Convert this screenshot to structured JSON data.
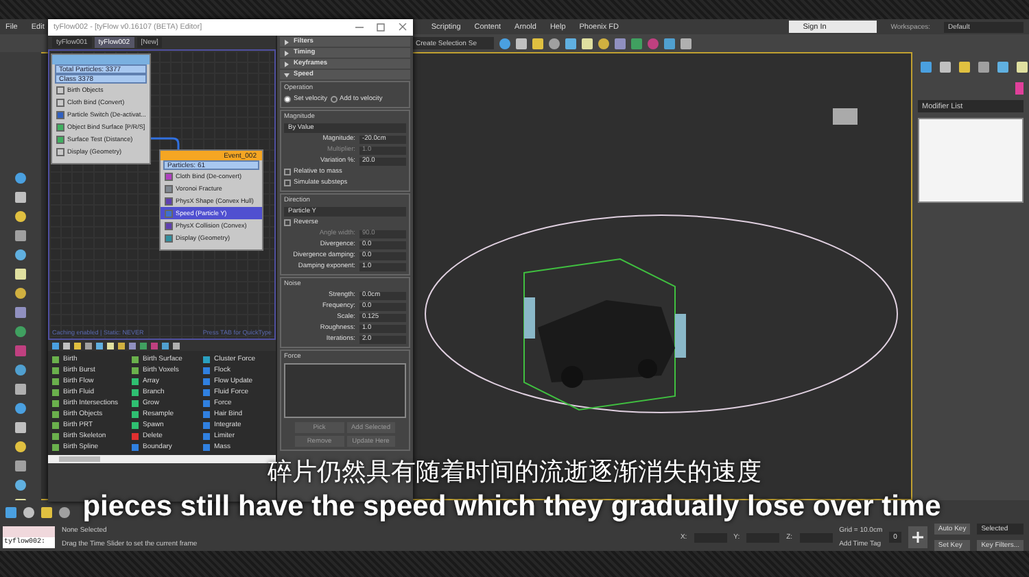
{
  "menu": {
    "left": [
      "File",
      "Edit"
    ],
    "right": [
      "Scripting",
      "Content",
      "Arnold",
      "Help",
      "Phoenix FD"
    ]
  },
  "sign_in": "Sign In",
  "workspaces": {
    "label": "Workspaces:",
    "value": "Default"
  },
  "toolbar": {
    "selection_set": "Create Selection Se"
  },
  "editor": {
    "title": "tyFlow002 - [tyFlow v0.16107 (BETA) Editor]",
    "tabs": [
      {
        "label": "tyFlow001",
        "selected": false
      },
      {
        "label": "tyFlow002",
        "selected": true
      },
      {
        "label": "[New]",
        "selected": false
      }
    ],
    "nodes": [
      {
        "stats": [
          "Total Particles: 3377",
          "Class 3378"
        ],
        "operators": [
          {
            "label": "Birth Objects",
            "selected": false,
            "color": "#c8c8c8"
          },
          {
            "label": "Cloth Bind (Convert)",
            "selected": false,
            "color": "#c8c8c8"
          },
          {
            "label": "Particle Switch (De-activat...",
            "selected": false,
            "color": "#3060c0"
          },
          {
            "label": "Object Bind Surface [P/R/S]",
            "selected": false,
            "color": "#40b060"
          },
          {
            "label": "Surface Test (Distance)",
            "selected": false,
            "color": "#40b060"
          },
          {
            "label": "Display (Geometry)",
            "selected": false,
            "color": "#c8c8c8"
          }
        ]
      },
      {
        "title": "Event_002",
        "stats": [
          "Particles: 61"
        ],
        "operators": [
          {
            "label": "Cloth Bind (De-convert)",
            "selected": false,
            "color": "#b040c0"
          },
          {
            "label": "Voronoi Fracture",
            "selected": false,
            "color": "#808890"
          },
          {
            "label": "PhysX Shape (Convex Hull)",
            "selected": false,
            "color": "#6040b0"
          },
          {
            "label": "Speed (Particle Y)",
            "selected": true,
            "color": "#4070d0"
          },
          {
            "label": "PhysX Collision (Convex)",
            "selected": false,
            "color": "#6040b0"
          },
          {
            "label": "Display (Geometry)",
            "selected": false,
            "color": "#3090a0"
          }
        ]
      }
    ],
    "status_left": "Caching enabled | Static: NEVER",
    "status_right": "Press TAB for QuickType",
    "palette": [
      [
        {
          "label": "Birth",
          "color": "#6ab04c"
        },
        {
          "label": "Birth Burst",
          "color": "#6ab04c"
        },
        {
          "label": "Birth Flow",
          "color": "#6ab04c"
        },
        {
          "label": "Birth Fluid",
          "color": "#6ab04c"
        },
        {
          "label": "Birth Intersections",
          "color": "#6ab04c"
        },
        {
          "label": "Birth Objects",
          "color": "#6ab04c"
        },
        {
          "label": "Birth PRT",
          "color": "#6ab04c"
        },
        {
          "label": "Birth Skeleton",
          "color": "#6ab04c"
        },
        {
          "label": "Birth Spline",
          "color": "#6ab04c"
        }
      ],
      [
        {
          "label": "Birth Surface",
          "color": "#6ab04c"
        },
        {
          "label": "Birth Voxels",
          "color": "#6ab04c"
        },
        {
          "label": "Array",
          "color": "#2fbf71"
        },
        {
          "label": "Branch",
          "color": "#2fbf71"
        },
        {
          "label": "Grow",
          "color": "#2fbf71"
        },
        {
          "label": "Resample",
          "color": "#2fbf71"
        },
        {
          "label": "Spawn",
          "color": "#2fbf71"
        },
        {
          "label": "Delete",
          "color": "#e03030"
        },
        {
          "label": "Boundary",
          "color": "#3080e0"
        }
      ],
      [
        {
          "label": "Cluster Force",
          "color": "#2aa0c0"
        },
        {
          "label": "Flock",
          "color": "#3080e0"
        },
        {
          "label": "Flow Update",
          "color": "#3080e0"
        },
        {
          "label": "Fluid Force",
          "color": "#3080e0"
        },
        {
          "label": "Force",
          "color": "#3080e0"
        },
        {
          "label": "Hair Bind",
          "color": "#3080e0"
        },
        {
          "label": "Integrate",
          "color": "#3080e0"
        },
        {
          "label": "Limiter",
          "color": "#3080e0"
        },
        {
          "label": "Mass",
          "color": "#3080e0"
        }
      ]
    ],
    "rollouts": [
      {
        "label": "Filters",
        "expanded": false
      },
      {
        "label": "Timing",
        "expanded": false
      },
      {
        "label": "Keyframes",
        "expanded": false
      },
      {
        "label": "Speed",
        "expanded": true
      }
    ],
    "operation": {
      "title": "Operation",
      "options": [
        {
          "label": "Set velocity",
          "selected": true
        },
        {
          "label": "Add to velocity",
          "selected": false
        }
      ]
    },
    "groups": [
      {
        "title": "Magnitude",
        "rows": [
          {
            "kind": "dropdown",
            "value": "By Value"
          },
          {
            "kind": "spinner",
            "label": "Magnitude:",
            "value": "-20.0cm",
            "disabled": false
          },
          {
            "kind": "spinner",
            "label": "Multiplier:",
            "value": "1.0",
            "disabled": true
          },
          {
            "kind": "spinner",
            "label": "Variation %:",
            "value": "20.0",
            "disabled": false
          },
          {
            "kind": "checkbox",
            "label": "Relative to mass",
            "checked": false
          },
          {
            "kind": "checkbox",
            "label": "Simulate substeps",
            "checked": false
          }
        ]
      },
      {
        "title": "Direction",
        "rows": [
          {
            "kind": "dropdown",
            "value": "Particle Y"
          },
          {
            "kind": "checkbox",
            "label": "Reverse",
            "checked": false
          },
          {
            "kind": "spinner",
            "label": "Angle width:",
            "value": "90.0",
            "disabled": true
          },
          {
            "kind": "spinner",
            "label": "Divergence:",
            "value": "0.0",
            "disabled": false
          },
          {
            "kind": "spinner",
            "label": "Divergence damping:",
            "value": "0.0",
            "disabled": false
          },
          {
            "kind": "spinner",
            "label": "Damping exponent:",
            "value": "1.0",
            "disabled": false
          }
        ]
      },
      {
        "title": "Noise",
        "rows": [
          {
            "kind": "spinner",
            "label": "Strength:",
            "value": "0.0cm",
            "disabled": false
          },
          {
            "kind": "spinner",
            "label": "Frequency:",
            "value": "0.0",
            "disabled": false
          },
          {
            "kind": "spinner",
            "label": "Scale:",
            "value": "0.125",
            "disabled": false
          },
          {
            "kind": "spinner",
            "label": "Roughness:",
            "value": "1.0",
            "disabled": false
          },
          {
            "kind": "spinner",
            "label": "Iterations:",
            "value": "2.0",
            "disabled": false
          }
        ]
      }
    ],
    "force": {
      "title": "Force",
      "buttons": [
        {
          "label": "Pick",
          "disabled": true
        },
        {
          "label": "Add Selected",
          "disabled": true
        },
        {
          "label": "Remove",
          "disabled": true
        },
        {
          "label": "Update Here",
          "disabled": true
        }
      ]
    }
  },
  "command_panel": {
    "modifier_list": "Modifier List"
  },
  "subtitles": {
    "zh": "碎片仍然具有随着时间的流逝逐渐消失的速度",
    "en": "pieces still have the speed which they gradually lose over time"
  },
  "status": {
    "maxscript": "tyflow002:",
    "selection": "None Selected",
    "prompt": "Drag the Time Slider to set the current frame",
    "coords": [
      "X:",
      "Y:",
      "Z:"
    ],
    "grid": "Grid = 10.0cm",
    "time_tag": "Add Time Tag",
    "frame": "0",
    "auto_key": "Auto Key",
    "key_mode": "Selected",
    "set_key": "Set Key",
    "key_filters": "Key Filters..."
  }
}
